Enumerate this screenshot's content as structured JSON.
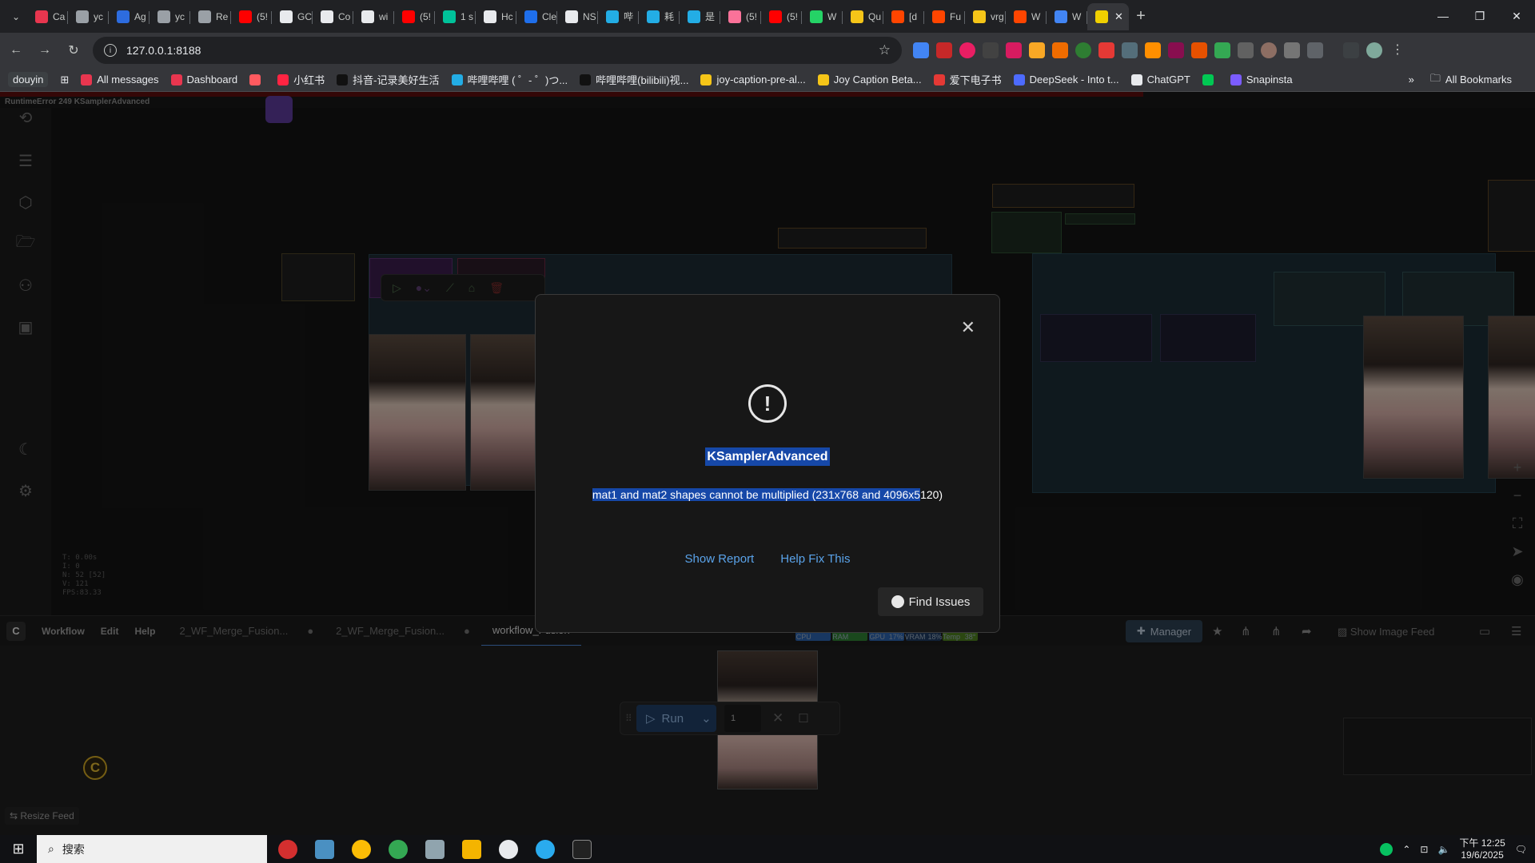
{
  "browser": {
    "tabs": [
      {
        "label": "Ca",
        "color": "#e8364f"
      },
      {
        "label": "yc",
        "color": "#9aa0a6"
      },
      {
        "label": "Ag",
        "color": "#2d6cdf"
      },
      {
        "label": "yc",
        "color": "#9aa0a6"
      },
      {
        "label": "Re",
        "color": "#9aa0a6"
      },
      {
        "label": "(5!",
        "color": "#ff0000"
      },
      {
        "label": "GC",
        "color": "#e8eaed"
      },
      {
        "label": "Co",
        "color": "#e8eaed"
      },
      {
        "label": "wi",
        "color": "#e8eaed"
      },
      {
        "label": "(5!",
        "color": "#ff0000"
      },
      {
        "label": "1 s",
        "color": "#00c29a"
      },
      {
        "label": "Hc",
        "color": "#e8eaed"
      },
      {
        "label": "Cle",
        "color": "#1f6feb"
      },
      {
        "label": "NS",
        "color": "#e8eaed"
      },
      {
        "label": "哔",
        "color": "#23ade5"
      },
      {
        "label": "耗",
        "color": "#23ade5"
      },
      {
        "label": "是",
        "color": "#23ade5"
      },
      {
        "label": "(5!",
        "color": "#fb7299"
      },
      {
        "label": "(5!",
        "color": "#ff0000"
      },
      {
        "label": "W",
        "color": "#25d366"
      },
      {
        "label": "Qu",
        "color": "#f5c518"
      },
      {
        "label": "[d",
        "color": "#ff4500"
      },
      {
        "label": "Fu",
        "color": "#ff4500"
      },
      {
        "label": "vrg",
        "color": "#f5c518"
      },
      {
        "label": "W",
        "color": "#ff4500"
      },
      {
        "label": "W",
        "color": "#4285f4"
      }
    ],
    "active_tab_label": "",
    "address": "127.0.0.1:8188",
    "bookmarks": [
      {
        "label": "douyin",
        "color": "#3c4043"
      },
      {
        "label": "All messages",
        "color": "#e8364f"
      },
      {
        "label": "Dashboard",
        "color": "#e8364f"
      },
      {
        "label": "",
        "color": "#ff5a5f"
      },
      {
        "label": "小红书",
        "color": "#ff2442"
      },
      {
        "label": "抖音-记录美好生活",
        "color": "#111111"
      },
      {
        "label": "哔哩哔哩 ( ゜- ゜)つ...",
        "color": "#23ade5"
      },
      {
        "label": "哔哩哔哩(bilibili)视...",
        "color": "#111111"
      },
      {
        "label": "joy-caption-pre-al...",
        "color": "#f5c518"
      },
      {
        "label": "Joy Caption Beta...",
        "color": "#f5c518"
      },
      {
        "label": "爱下电子书",
        "color": "#e53935"
      },
      {
        "label": "DeepSeek - Into t...",
        "color": "#4d6bfe"
      },
      {
        "label": "ChatGPT",
        "color": "#e8eaed"
      },
      {
        "label": "",
        "color": "#00c853"
      },
      {
        "label": "Snapinsta",
        "color": "#7b5cff"
      }
    ],
    "all_bookmarks": "All Bookmarks",
    "more": "»"
  },
  "app": {
    "error_banner": "RuntimeError 249 KSamplerAdvanced",
    "stats": [
      "T: 0.00s",
      "I: 0",
      "N: 52 [52]",
      "V: 121",
      "FPS:83.33"
    ],
    "menu": [
      "Workflow",
      "Edit",
      "Help"
    ],
    "workflow_tabs": [
      {
        "label": "2_WF_Merge_Fusion...",
        "dot": "●"
      },
      {
        "label": "2_WF_Merge_Fusion...",
        "dot": "●"
      },
      {
        "label": "workflow_Fusion",
        "dot": ""
      }
    ],
    "monitor": [
      {
        "label": "CPU",
        "value": "",
        "color": "#2a5fa8"
      },
      {
        "label": "RAM",
        "value": "",
        "color": "#2e7d32"
      },
      {
        "label": "GPU",
        "value": "17%",
        "color": "#2a5fa8"
      },
      {
        "label": "VRAM",
        "value": "18%",
        "color": "#1e3a5f"
      },
      {
        "label": "Temp",
        "value": "38°",
        "color": "#4a7a1e"
      }
    ],
    "manager_label": "Manager",
    "show_image_feed": "Show Image Feed",
    "resize_feed": "Resize Feed",
    "run_label": "Run",
    "batch_count": "1"
  },
  "dialog": {
    "title": "KSamplerAdvanced",
    "message_selected": "mat1 and mat2 shapes cannot be multiplied (231x768 and 4096x5",
    "message_rest": "120)",
    "show_report": "Show Report",
    "help_fix": "Help Fix This",
    "find_issues": "Find Issues"
  },
  "taskbar": {
    "search_placeholder": "搜索",
    "time": "下午 12:25",
    "date": "19/6/2025"
  }
}
